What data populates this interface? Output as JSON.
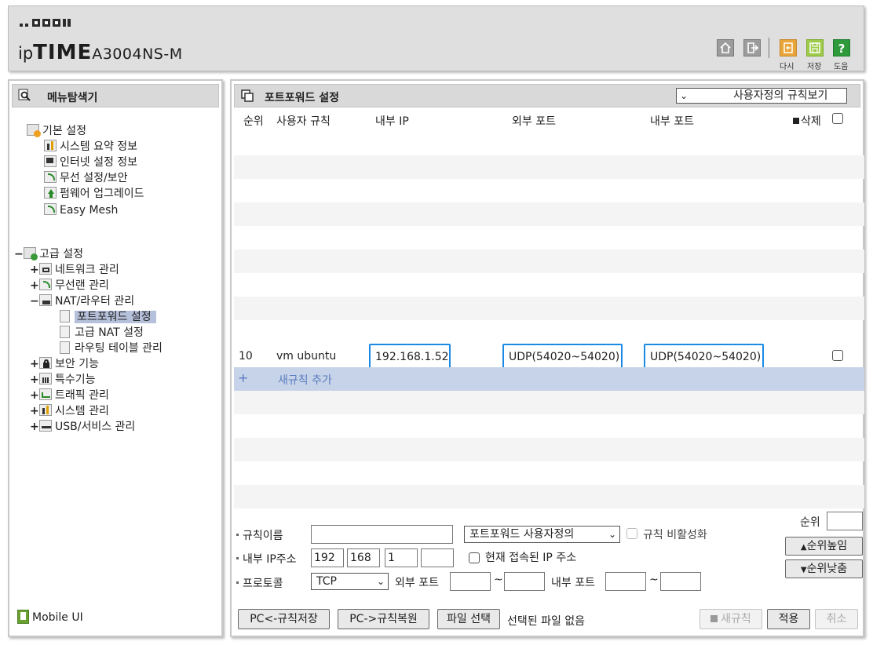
{
  "header": {
    "brand_ip": "ip",
    "brand_time": "TIME",
    "model": "A3004NS-M",
    "actions": [
      {
        "label": "다시",
        "icon": "reload-icon"
      },
      {
        "label": "저장",
        "icon": "save-icon"
      },
      {
        "label": "도움",
        "icon": "help-icon"
      }
    ]
  },
  "sidebar": {
    "title": "메뉴탐색기",
    "basic": {
      "label": "기본 설정",
      "items": [
        "시스템 요약 정보",
        "인터넷 설정 정보",
        "무선 설정/보안",
        "펌웨어 업그레이드",
        "Easy Mesh"
      ]
    },
    "advanced": {
      "label": "고급 설정",
      "items": [
        "네트워크 관리",
        "무선랜 관리",
        "NAT/라우터 관리",
        "보안 기능",
        "특수기능",
        "트래픽 관리",
        "시스템 관리",
        "USB/서비스 관리"
      ],
      "nat_children": [
        "포트포워드 설정",
        "고급 NAT 설정",
        "라우팅 테이블 관리"
      ]
    },
    "mobile": "Mobile UI"
  },
  "main": {
    "title": "포트포워드 설정",
    "view_select": "사용자정의 규칙보기",
    "columns": [
      "순위",
      "사용자 규칙",
      "내부 IP",
      "외부 포트",
      "내부 포트",
      "삭제"
    ],
    "rule": {
      "rank": "10",
      "name": "vm ubuntu",
      "internal_ip": "192.168.1.52",
      "external_port": "UDP(54020~54020)",
      "internal_port": "UDP(54020~54020)"
    },
    "add_rule": "새규칙 추가",
    "form": {
      "rule_name_label": "규칙이름",
      "rule_name_value": "",
      "type_select": "포트포워드 사용자정의",
      "disable_label": "규칙 비활성화",
      "ip_label": "내부 IP주소",
      "ip_parts": [
        "192",
        "168",
        "1",
        ""
      ],
      "current_ip_label": "현재 접속된 IP 주소",
      "protocol_label": "프로토콜",
      "protocol_value": "TCP",
      "ext_port_label": "외부 포트",
      "int_port_label": "내부 포트",
      "tilde": "~",
      "rank_label": "순위",
      "rank_value": "",
      "rank_up": "순위높임",
      "rank_down": "순위낮춤"
    },
    "bottom": {
      "save_to_pc": "PC<-규칙저장",
      "restore_from_pc": "PC->규칙복원",
      "file_select": "파일 선택",
      "no_file": "선택된 파일 없음",
      "new_rule": "새규칙",
      "apply": "적용",
      "cancel": "취소"
    }
  }
}
